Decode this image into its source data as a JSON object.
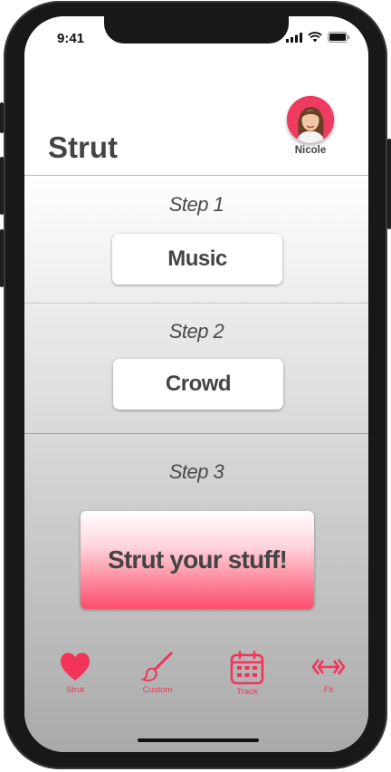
{
  "status_bar": {
    "time": "9:41",
    "icons": [
      "signal-icon",
      "wifi-icon",
      "battery-icon"
    ]
  },
  "header": {
    "title": "Strut",
    "profile": {
      "name": "Nicole"
    }
  },
  "steps": [
    {
      "label": "Step 1",
      "button": "Music"
    },
    {
      "label": "Step 2",
      "button": "Crowd"
    },
    {
      "label": "Step 3",
      "button": "Strut your stuff!"
    }
  ],
  "tabbar": {
    "items": [
      {
        "label": "Strut",
        "icon": "heart-icon"
      },
      {
        "label": "Custom",
        "icon": "paintbrush-icon"
      },
      {
        "label": "Track",
        "icon": "calendar-icon"
      },
      {
        "label": "Fit",
        "icon": "dumbbell-icon"
      }
    ]
  },
  "colors": {
    "accent": "#f2345a",
    "text": "#444444",
    "avatar_bg": "#ef3b5f"
  }
}
